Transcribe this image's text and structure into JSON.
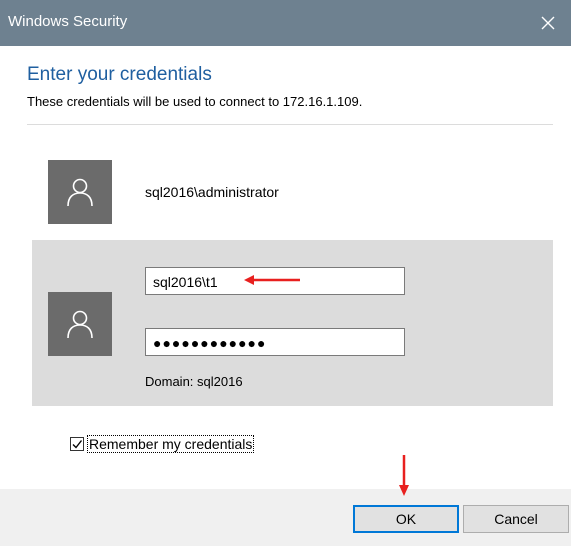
{
  "window": {
    "title": "Windows Security",
    "close_icon": "close-icon"
  },
  "dialog": {
    "heading": "Enter your credentials",
    "subheading": "These credentials will be used to connect to 172.16.1.109."
  },
  "accounts": {
    "existing": {
      "avatar_icon": "user-icon",
      "name": "sql2016\\administrator"
    },
    "selected": {
      "avatar_icon": "user-icon",
      "username_value": "sql2016\\t1",
      "password_masked": "●●●●●●●●●●●●",
      "domain_text": "Domain: sql2016"
    }
  },
  "remember": {
    "label": "Remember my credentials",
    "checked": true
  },
  "buttons": {
    "ok_label": "OK",
    "cancel_label": "Cancel"
  },
  "annotations": {
    "arrow_color": "#e8201f"
  },
  "colors": {
    "titlebar": "#6e8190",
    "heading": "#1f5fa0",
    "selected_panel": "#dcdcdc",
    "avatar": "#6b6b6b",
    "footer": "#f0f0f0",
    "ok_border": "#0078d7"
  }
}
